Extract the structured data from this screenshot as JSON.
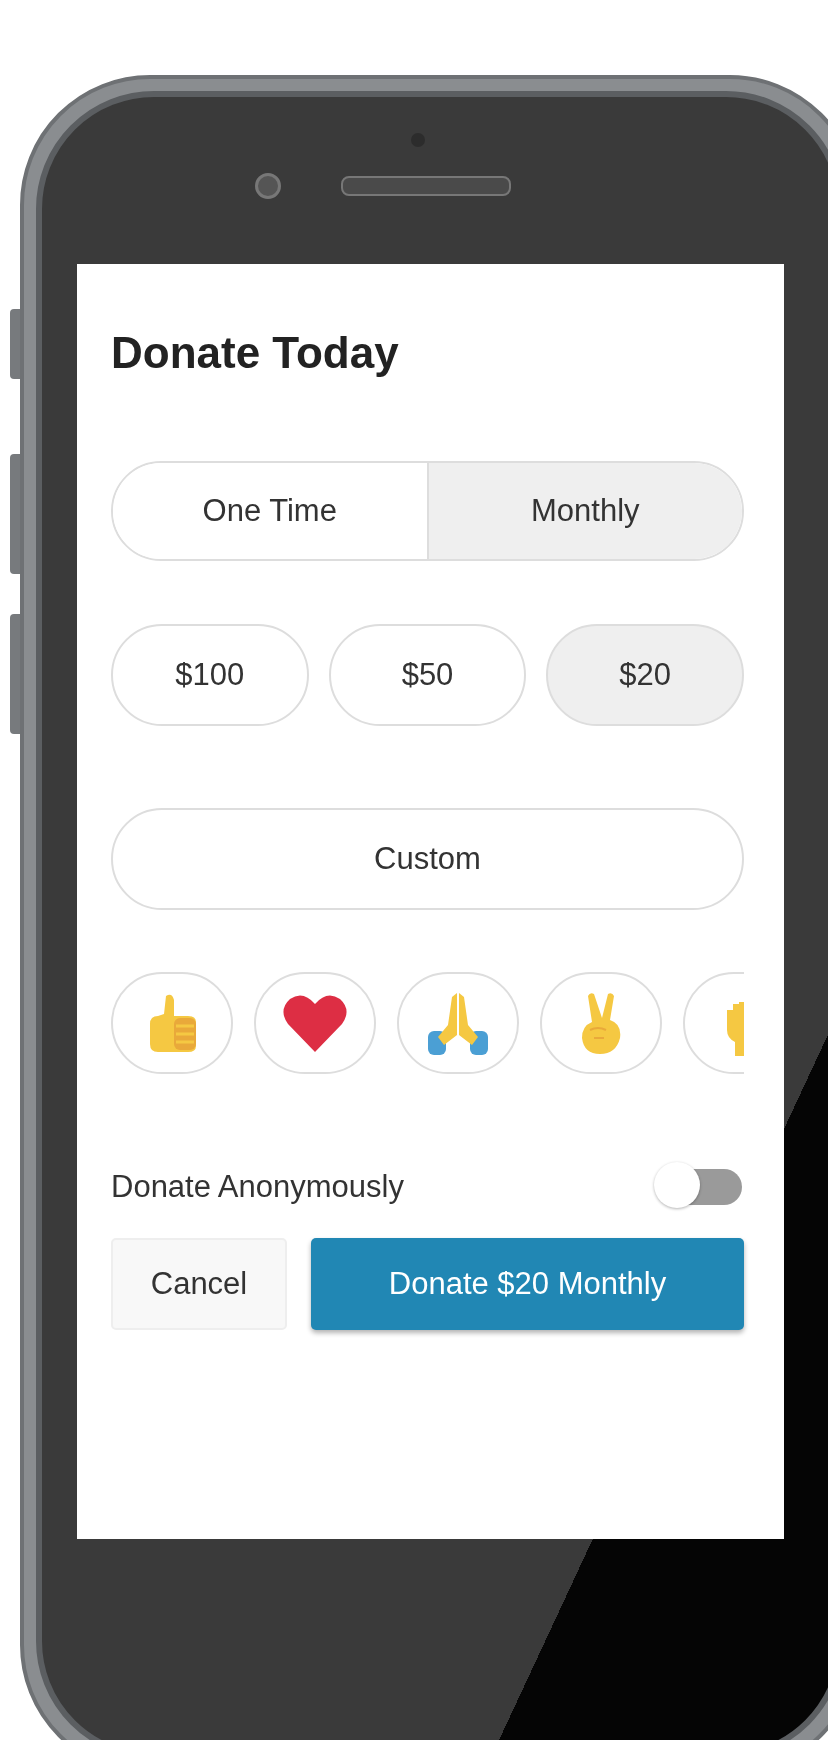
{
  "title": "Donate Today",
  "frequency": [
    {
      "label": "One Time",
      "selected": false
    },
    {
      "label": "Monthly",
      "selected": true
    }
  ],
  "amounts": [
    {
      "label": "$100",
      "selected": false
    },
    {
      "label": "$50",
      "selected": false
    },
    {
      "label": "$20",
      "selected": true
    }
  ],
  "custom": {
    "label": "Custom"
  },
  "reactions": [
    {
      "kind": "thumbs_up",
      "selected": false
    },
    {
      "kind": "heart",
      "selected": false
    },
    {
      "kind": "praying",
      "selected": false
    },
    {
      "kind": "peace",
      "selected": false
    },
    {
      "kind": "raised_hand",
      "selected": false
    }
  ],
  "anonymous": {
    "label": "Donate Anonymously",
    "on": false
  },
  "buttons": {
    "cancel": "Cancel",
    "donate": "Donate $20 Monthly"
  }
}
